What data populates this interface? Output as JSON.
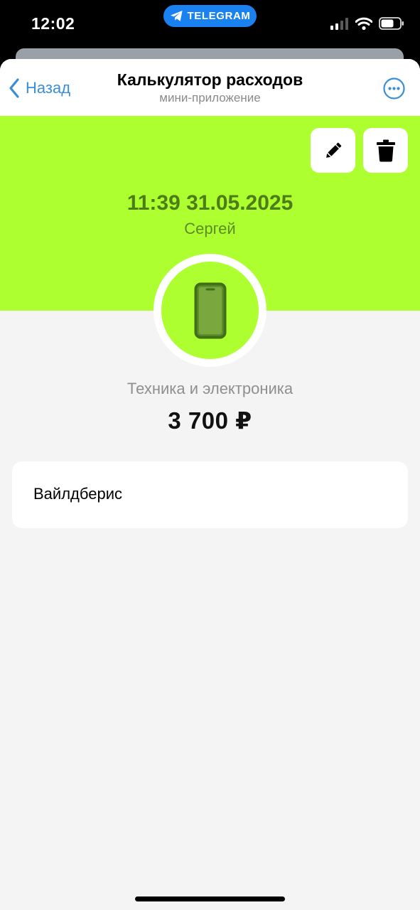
{
  "status_bar": {
    "time": "12:02",
    "pill_label": "TELEGRAM",
    "pill_icon": "telegram-plane-icon",
    "icons": [
      "cellular-signal-icon",
      "wifi-icon",
      "battery-icon"
    ]
  },
  "header": {
    "back_label": "Назад",
    "title": "Калькулятор расходов",
    "subtitle": "мини-приложение",
    "more_icon": "more-options-icon"
  },
  "expense": {
    "datetime": "11:39 31.05.2025",
    "person": "Сергей",
    "category": "Техника и электроника",
    "category_icon": "smartphone-icon",
    "amount": "3 700 ₽",
    "note": "Вайлдберис",
    "actions": [
      "edit-icon",
      "delete-icon"
    ]
  },
  "colors": {
    "accent": "#adff2f",
    "accent_text": "#4d7d18",
    "link": "#3a8ed6",
    "telegram": "#1a82f0",
    "background": "#f4f4f4"
  }
}
